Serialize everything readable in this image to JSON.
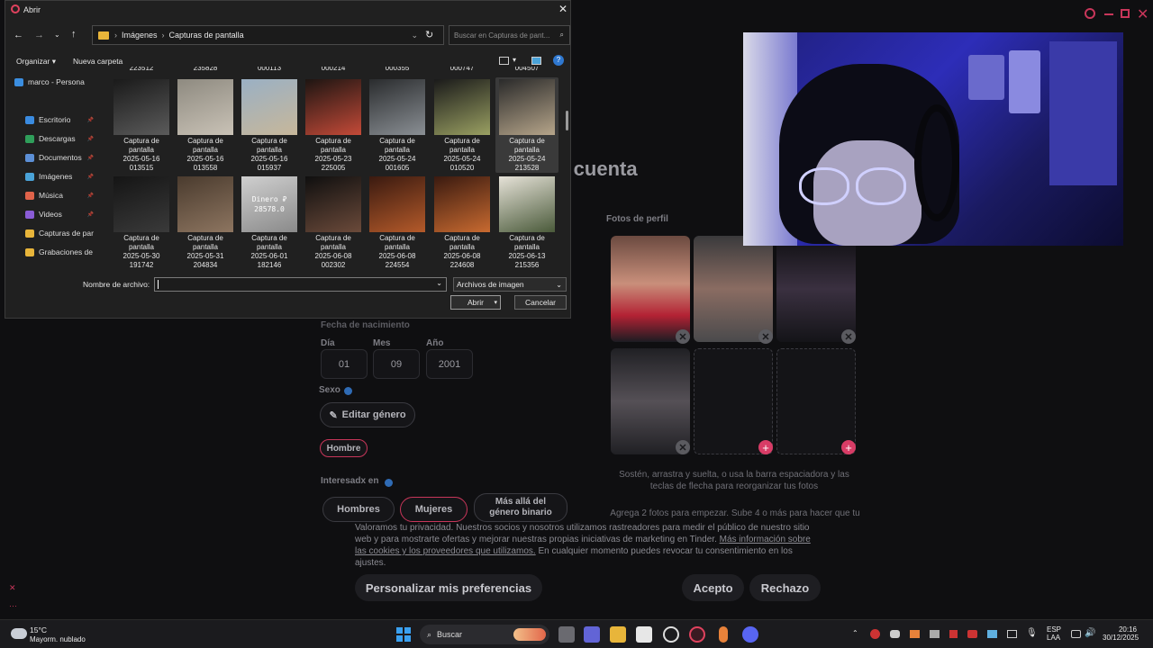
{
  "background": {
    "heading": "r cuenta",
    "profile_photos_label": "Fotos de perfil",
    "birthdate_label": "Fecha de nacimiento",
    "day_label": "Día",
    "month_label": "Mes",
    "year_label": "Año",
    "day_value": "01",
    "month_value": "09",
    "year_value": "2001",
    "gender_label": "Sexo",
    "edit_gender": "Editar género",
    "gender_value": "Hombre",
    "interested_label": "Interesadx en",
    "interest_options": [
      "Hombres",
      "Mujeres",
      "Más allá del género binario"
    ],
    "photos_hint": "Sostén, arrastra y suelta, o usa la barra espaciadora y las teclas de flecha para reorganizar tus fotos",
    "photos_hint2": "Agrega 2 fotos para empezar. Sube 4 o más para hacer que tu",
    "cookie_text_1": "Valoramos tu privacidad. Nuestros socios y nosotros utilizamos rastreadores para medir el público de nuestro sitio web y para mostrarte ofertas y mejorar nuestras propias iniciativas de marketing en Tinder.",
    "cookie_link": "Más información sobre las cookies y los proveedores que utilizamos.",
    "cookie_text_2": "En cualquier momento puedes revocar tu consentimiento en los ajustes.",
    "btn_prefs": "Personalizar mis preferencias",
    "btn_accept": "Acepto",
    "btn_reject": "Rechazo",
    "colors": {
      "accent": "#d83c66",
      "bg": "#0f0f11"
    }
  },
  "dialog": {
    "title": "Abrir",
    "breadcrumb": [
      "Imágenes",
      "Capturas de pantalla"
    ],
    "search_placeholder": "Buscar en Capturas de pant...",
    "organize": "Organizar",
    "new_folder": "Nueva carpeta",
    "nav_items": [
      {
        "label": "marco - Persona",
        "icon": "cloud-icon",
        "color": "#3b8ee0"
      },
      {
        "label": "Escritorio",
        "icon": "desktop-icon",
        "color": "#3a8be0"
      },
      {
        "label": "Descargas",
        "icon": "download-icon",
        "color": "#2f9e5a"
      },
      {
        "label": "Documentos",
        "icon": "document-icon",
        "color": "#5c8fd6"
      },
      {
        "label": "Imágenes",
        "icon": "pictures-icon",
        "color": "#4aa3d8"
      },
      {
        "label": "Música",
        "icon": "music-icon",
        "color": "#e0634a"
      },
      {
        "label": "Videos",
        "icon": "video-icon",
        "color": "#8a5cd6"
      },
      {
        "label": "Capturas de par",
        "icon": "folder-icon",
        "color": "#e8b53a"
      },
      {
        "label": "Grabaciones de",
        "icon": "folder-icon",
        "color": "#e8b53a"
      }
    ],
    "top_partial": [
      "223512",
      "235828",
      "000113",
      "000214",
      "000355",
      "000747",
      "004507"
    ],
    "row1": [
      {
        "date": "2025-05-16",
        "time": "013515",
        "c1": "#1a1a1a",
        "c2": "#5b5b5b"
      },
      {
        "date": "2025-05-16",
        "time": "013558",
        "c1": "#8e8a80",
        "c2": "#c9c2b6"
      },
      {
        "date": "2025-05-16",
        "time": "015937",
        "c1": "#9ab0c4",
        "c2": "#c7b79a"
      },
      {
        "date": "2025-05-23",
        "time": "225005",
        "c1": "#1d1512",
        "c2": "#c44a38"
      },
      {
        "date": "2025-05-24",
        "time": "001605",
        "c1": "#2a2c2e",
        "c2": "#8a8f94"
      },
      {
        "date": "2025-05-24",
        "time": "010520",
        "c1": "#1a1a1a",
        "c2": "#9aa062"
      },
      {
        "date": "2025-05-24",
        "time": "213528",
        "c1": "#2a2a2a",
        "c2": "#b6a58a"
      }
    ],
    "row2": [
      {
        "date": "2025-05-30",
        "time": "191742",
        "c1": "#151515",
        "c2": "#3a3a3a"
      },
      {
        "date": "2025-05-31",
        "time": "204834",
        "c1": "#4a3b2e",
        "c2": "#8d7560"
      },
      {
        "date": "2025-06-01",
        "time": "182146",
        "c1": "#cfcfcf",
        "c2": "#8a8a8a",
        "text": "Dinero ₽ 28578.0"
      },
      {
        "date": "2025-06-08",
        "time": "002302",
        "c1": "#0f0f0f",
        "c2": "#6b4a3a"
      },
      {
        "date": "2025-06-08",
        "time": "224554",
        "c1": "#3a1a10",
        "c2": "#b45a2a"
      },
      {
        "date": "2025-06-08",
        "time": "224608",
        "c1": "#3a1a10",
        "c2": "#c86a30"
      },
      {
        "date": "2025-06-13",
        "time": "215356",
        "c1": "#e6e2d8",
        "c2": "#4a5a3a"
      }
    ],
    "caption_prefix": "Captura de pantalla",
    "filename_label": "Nombre de archivo:",
    "filename_value": "",
    "filetype": "Archivos de imagen",
    "open_btn": "Abrir",
    "cancel_btn": "Cancelar"
  },
  "taskbar": {
    "weather_temp": "15°C",
    "weather_desc": "Mayorm. nublado",
    "search": "Buscar",
    "lang1": "ESP",
    "lang2": "LAA",
    "time": "20:16",
    "date": "30/12/2025"
  }
}
